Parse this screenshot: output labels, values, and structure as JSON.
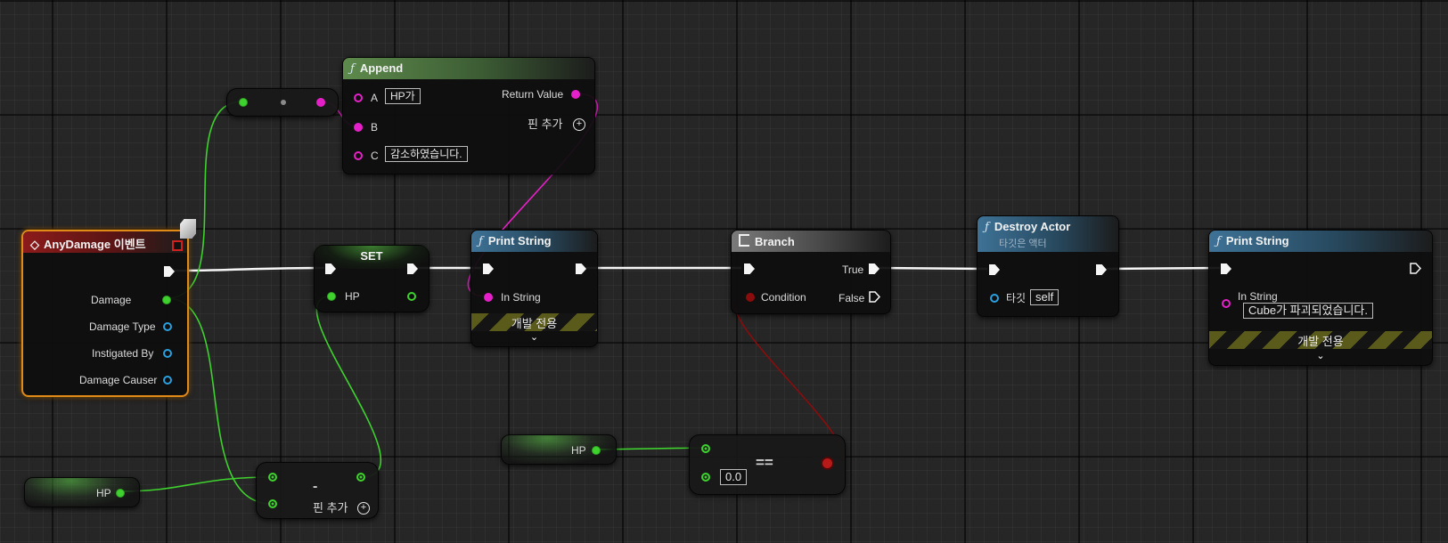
{
  "nodes": {
    "append": {
      "title": "Append",
      "pin_a": "A",
      "pin_a_value": "HP가",
      "pin_b": "B",
      "pin_c": "C",
      "pin_c_value": "감소하였습니다.",
      "return_value": "Return Value",
      "add_pin": "핀 추가"
    },
    "any_damage": {
      "title": "AnyDamage 이벤트",
      "damage": "Damage",
      "damage_type": "Damage Type",
      "instigated_by": "Instigated By",
      "damage_causer": "Damage Causer"
    },
    "set": {
      "title": "SET",
      "hp": "HP"
    },
    "print_string_1": {
      "title": "Print String",
      "in_string": "In String",
      "dev_only": "개발 전용"
    },
    "branch": {
      "title": "Branch",
      "condition": "Condition",
      "true_label": "True",
      "false_label": "False"
    },
    "destroy_actor": {
      "title": "Destroy Actor",
      "subtitle": "타깃은 액터",
      "target": "타깃",
      "target_value": "self"
    },
    "print_string_2": {
      "title": "Print String",
      "in_string": "In String",
      "in_string_value": "Cube가 파괴되었습니다.",
      "dev_only": "개발 전용"
    },
    "subtract": {
      "op": "-",
      "add_pin": "핀 추가"
    },
    "equals": {
      "op": "==",
      "value": "0.0"
    },
    "hp_var_1": {
      "label": "HP"
    },
    "hp_var_2": {
      "label": "HP"
    }
  },
  "icons": {
    "function": "ƒ",
    "event": "◇",
    "branch": "branch-icon",
    "chevron": "⌄",
    "add": "+"
  },
  "colors": {
    "float_pin": "#3fd12e",
    "string_pin": "#e620c8",
    "object_pin": "#2aa0e0",
    "bool_pin": "#8a0c0c",
    "exec_wire": "#f5f5f5",
    "event_outline": "#e08a18"
  }
}
